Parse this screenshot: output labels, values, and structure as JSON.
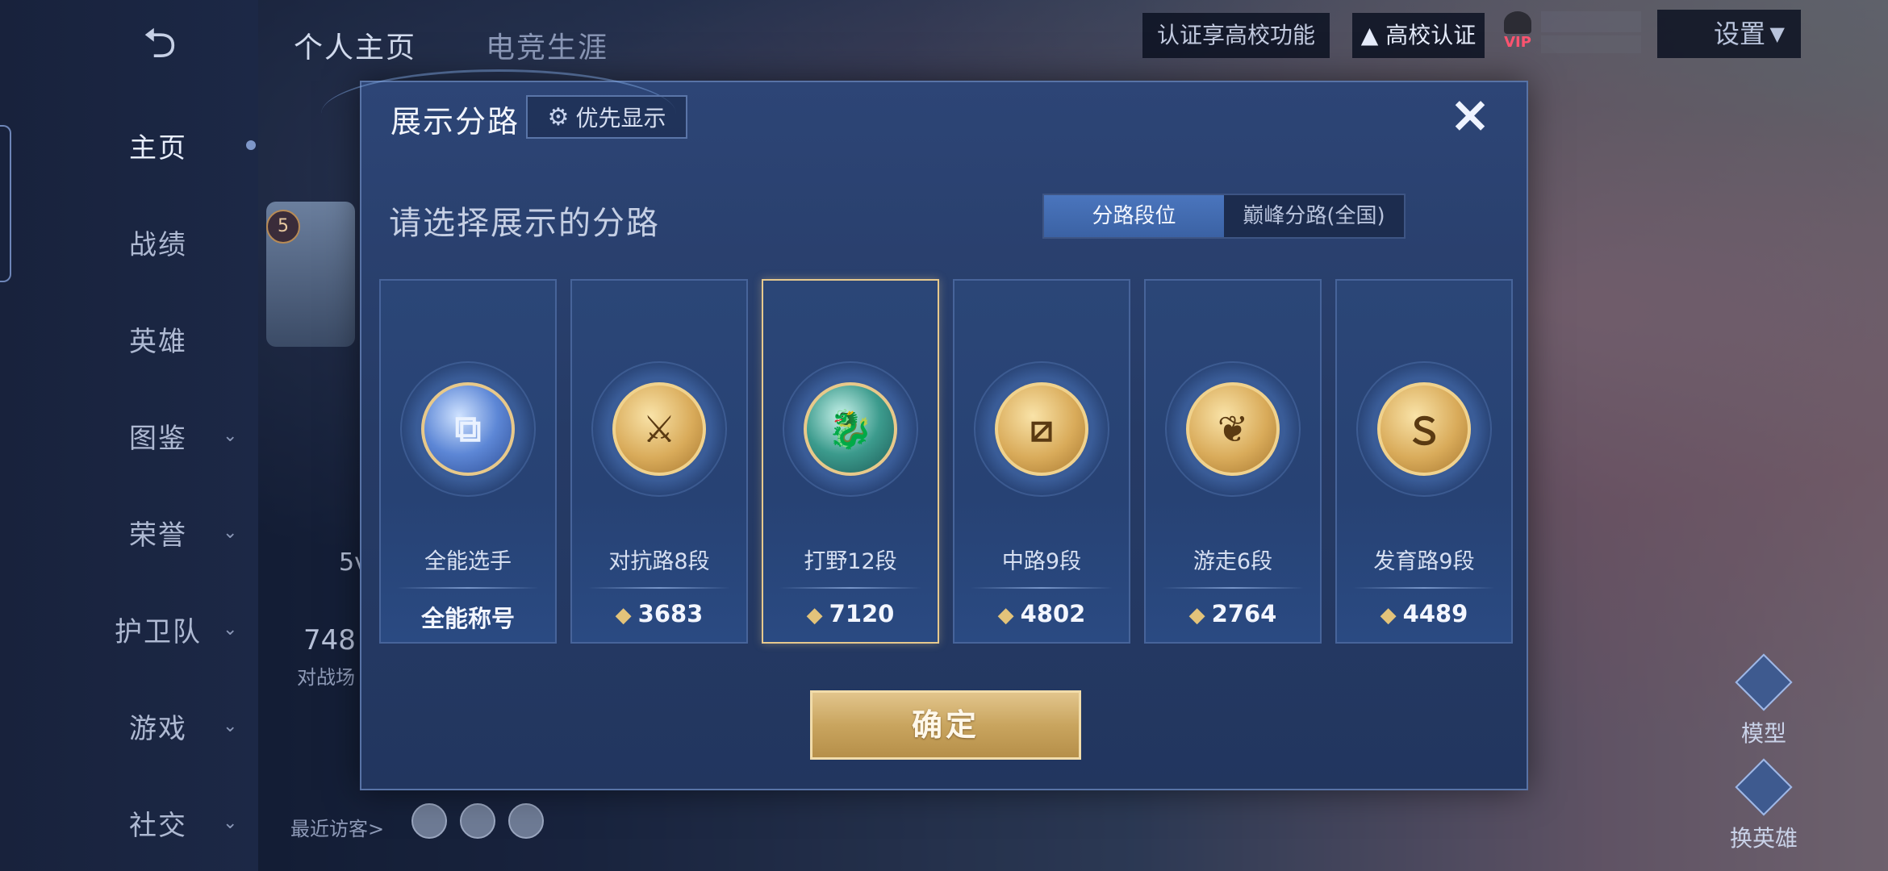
{
  "sidenav": {
    "items": [
      {
        "label": "主页",
        "chevron": false,
        "active": true
      },
      {
        "label": "战绩",
        "chevron": false
      },
      {
        "label": "英雄",
        "chevron": false
      },
      {
        "label": "图鉴",
        "chevron": true
      },
      {
        "label": "荣誉",
        "chevron": true
      },
      {
        "label": "护卫队",
        "chevron": true
      },
      {
        "label": "游戏",
        "chevron": true
      },
      {
        "label": "社交",
        "chevron": true
      }
    ]
  },
  "header": {
    "tabs": [
      "个人主页",
      "电竞生涯"
    ],
    "auth_text": "认证享高校功能",
    "campus_text": "高校认证",
    "vip_label": "VIP",
    "settings_label": "设置"
  },
  "background": {
    "level": "5",
    "mode_text": "5v",
    "battle_count": "748",
    "battle_label": "对战场",
    "recent_visitors": "最近访客>",
    "right_buttons": [
      "模型",
      "换英雄"
    ]
  },
  "modal": {
    "title": "展示分路",
    "priority_label": "优先显示",
    "close_icon": "×",
    "subtitle": "请选择展示的分路",
    "segments": [
      "分路段位",
      "巅峰分路(全国)"
    ],
    "active_segment": 0,
    "cards": [
      {
        "name": "全能选手",
        "value": "全能称号",
        "emblem": "blue",
        "has_gem": false,
        "selected": false
      },
      {
        "name": "对抗路8段",
        "value": "3683",
        "emblem": "gold",
        "has_gem": true,
        "selected": false
      },
      {
        "name": "打野12段",
        "value": "7120",
        "emblem": "teal",
        "has_gem": true,
        "selected": true
      },
      {
        "name": "中路9段",
        "value": "4802",
        "emblem": "gold",
        "has_gem": true,
        "selected": false
      },
      {
        "name": "游走6段",
        "value": "2764",
        "emblem": "gold",
        "has_gem": true,
        "selected": false
      },
      {
        "name": "发育路9段",
        "value": "4489",
        "emblem": "gold",
        "has_gem": true,
        "selected": false
      }
    ],
    "confirm_label": "确定"
  },
  "colors": {
    "modal_bg": "#263b66",
    "accent_gold": "#e6c98e",
    "segment_active": "#4a75bd"
  }
}
